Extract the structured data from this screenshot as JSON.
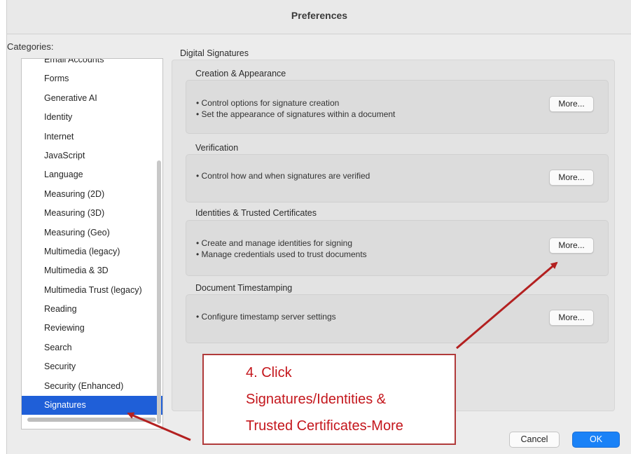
{
  "window": {
    "title": "Preferences"
  },
  "sidebar": {
    "label": "Categories:",
    "items": [
      {
        "label": "Email Accounts"
      },
      {
        "label": "Forms"
      },
      {
        "label": "Generative AI"
      },
      {
        "label": "Identity"
      },
      {
        "label": "Internet"
      },
      {
        "label": "JavaScript"
      },
      {
        "label": "Language"
      },
      {
        "label": "Measuring (2D)"
      },
      {
        "label": "Measuring (3D)"
      },
      {
        "label": "Measuring (Geo)"
      },
      {
        "label": "Multimedia (legacy)"
      },
      {
        "label": "Multimedia & 3D"
      },
      {
        "label": "Multimedia Trust (legacy)"
      },
      {
        "label": "Reading"
      },
      {
        "label": "Reviewing"
      },
      {
        "label": "Search"
      },
      {
        "label": "Security"
      },
      {
        "label": "Security (Enhanced)"
      },
      {
        "label": "Signatures",
        "selected": true
      }
    ]
  },
  "main": {
    "section_title": "Digital Signatures",
    "groups": [
      {
        "title": "Creation & Appearance",
        "bullets": [
          "• Control options for signature creation",
          "• Set the appearance of signatures within a document"
        ],
        "button": "More..."
      },
      {
        "title": "Verification",
        "bullets": [
          "• Control how and when signatures are verified"
        ],
        "button": "More..."
      },
      {
        "title": "Identities & Trusted Certificates",
        "bullets": [
          "• Create and manage identities for signing",
          "• Manage credentials used to trust documents"
        ],
        "button": "More..."
      },
      {
        "title": "Document Timestamping",
        "bullets": [
          "• Configure timestamp server settings"
        ],
        "button": "More..."
      }
    ]
  },
  "footer": {
    "cancel_label": "Cancel",
    "ok_label": "OK"
  },
  "annotation": {
    "lines": [
      "4. Click",
      "Signatures/Identities &",
      "Trusted Certificates-More"
    ],
    "color": "#c4161c",
    "arrow_color": "#b32020"
  },
  "colors": {
    "accent": "#1a82f7",
    "selection": "#1f5fd8"
  }
}
